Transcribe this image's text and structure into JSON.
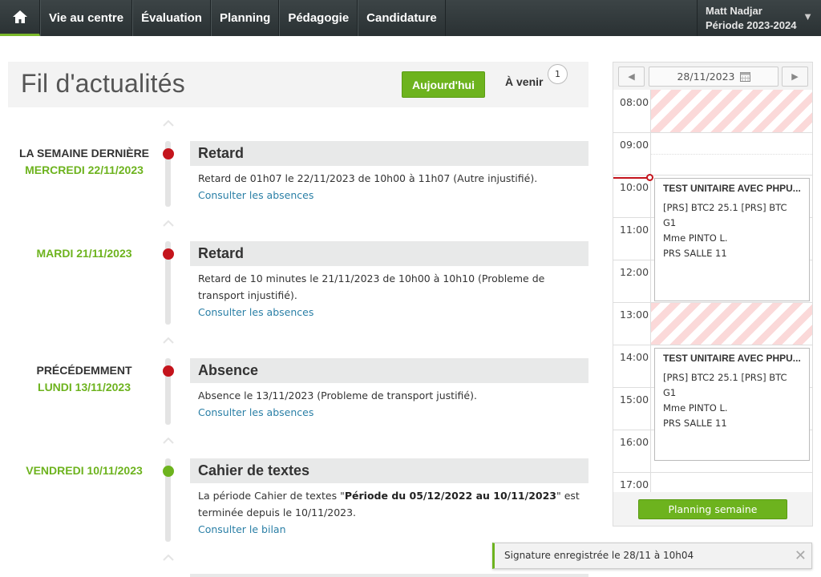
{
  "nav": {
    "home_icon": "home-icon",
    "items": [
      {
        "label": "Vie au centre"
      },
      {
        "label": "Évaluation"
      },
      {
        "label": "Planning"
      },
      {
        "label": "Pédagogie"
      },
      {
        "label": "Candidature"
      }
    ],
    "user": {
      "name": "Matt Nadjar",
      "period": "Période 2023-2024"
    }
  },
  "header": {
    "title": "Fil d'actualités",
    "today_label": "Aujourd'hui",
    "upcoming_label": "À venir",
    "upcoming_count": "1"
  },
  "feed": [
    {
      "rel": "LA SEMAINE DERNIÈRE",
      "date": "MERCREDI 22/11/2023",
      "title": "Retard",
      "text": "Retard de 01h07 le 22/11/2023 de 10h00 à 11h07 (Autre injustifié).",
      "link": "Consulter les absences",
      "status": "red"
    },
    {
      "rel": "",
      "date": "MARDI 21/11/2023",
      "title": "Retard",
      "text": "Retard de 10 minutes le 21/11/2023 de 10h00 à 10h10 (Probleme de transport injustifié).",
      "link": "Consulter les absences",
      "status": "red"
    },
    {
      "rel": "PRÉCÉDEMMENT",
      "date": "LUNDI 13/11/2023",
      "title": "Absence",
      "text": "Absence le 13/11/2023 (Probleme de transport justifié).",
      "link": "Consulter les absences",
      "status": "red"
    },
    {
      "rel": "",
      "date": "VENDREDI 10/11/2023",
      "title": "Cahier de textes",
      "text_before": "La période Cahier de textes \"",
      "text_bold": "Période du 05/12/2022 au 10/11/2023",
      "text_after": "\" est terminée depuis le 10/11/2023.",
      "link": "Consulter le bilan",
      "status": "green"
    }
  ],
  "calendar": {
    "date": "28/11/2023",
    "hours": [
      "08:00",
      "09:00",
      "10:00",
      "11:00",
      "12:00",
      "13:00",
      "14:00",
      "15:00",
      "16:00",
      "17:00"
    ],
    "events": [
      {
        "title": "TEST UNITAIRE AVEC PHPU...",
        "group": "[PRS] BTC2 25.1 [PRS] BTC G1",
        "teacher": "Mme PINTO L.",
        "room": "PRS SALLE 11"
      },
      {
        "title": "TEST UNITAIRE AVEC PHPU...",
        "group": "[PRS] BTC2 25.1 [PRS] BTC G1",
        "teacher": "Mme PINTO L.",
        "room": "PRS SALLE 11"
      }
    ],
    "week_button": "Planning semaine"
  },
  "toast": {
    "message": "Signature enregistrée le 28/11 à 10h04",
    "close": "✕"
  },
  "colors": {
    "accent": "#6db31e",
    "alert": "#c4141c",
    "link": "#2a7fa6",
    "nav": "#2f3638"
  }
}
